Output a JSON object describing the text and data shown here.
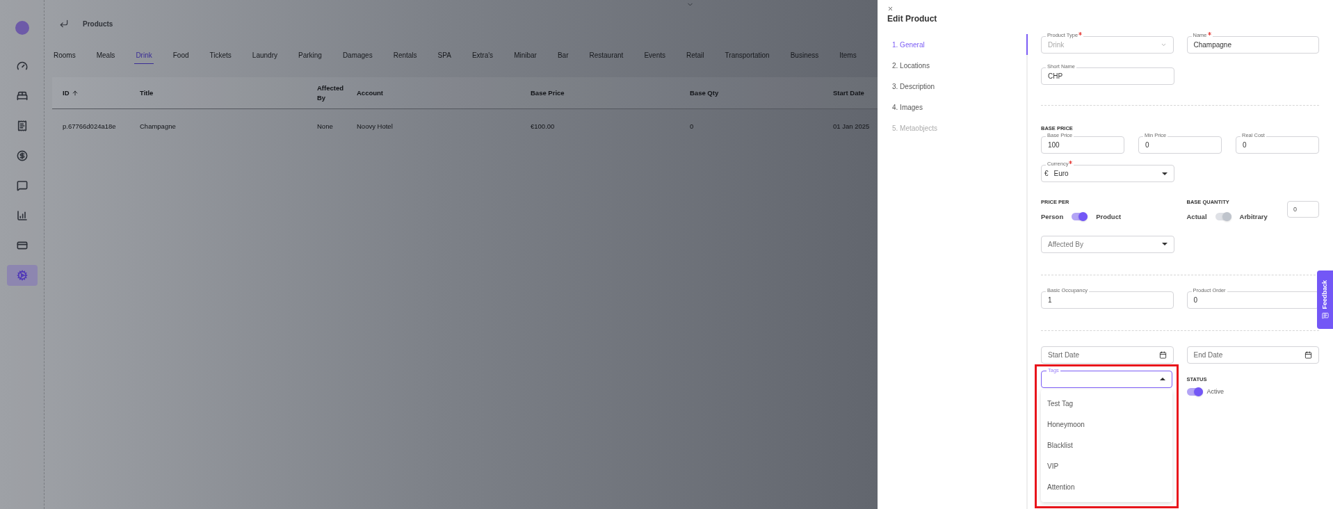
{
  "sidebar": {
    "items": [
      {
        "selected": false
      },
      {
        "selected": false
      },
      {
        "selected": false
      },
      {
        "selected": false
      },
      {
        "selected": false
      },
      {
        "selected": false
      },
      {
        "selected": false
      },
      {
        "selected": true
      }
    ]
  },
  "header": {
    "title": "Products"
  },
  "tabs": [
    {
      "label": "Rooms",
      "selected": false
    },
    {
      "label": "Meals",
      "selected": false
    },
    {
      "label": "Drink",
      "selected": true
    },
    {
      "label": "Food",
      "selected": false
    },
    {
      "label": "Tickets",
      "selected": false
    },
    {
      "label": "Laundry",
      "selected": false
    },
    {
      "label": "Parking",
      "selected": false
    },
    {
      "label": "Damages",
      "selected": false
    },
    {
      "label": "Rentals",
      "selected": false
    },
    {
      "label": "SPA",
      "selected": false
    },
    {
      "label": "Extra's",
      "selected": false
    },
    {
      "label": "Minibar",
      "selected": false
    },
    {
      "label": "Bar",
      "selected": false
    },
    {
      "label": "Restaurant",
      "selected": false
    },
    {
      "label": "Events",
      "selected": false
    },
    {
      "label": "Retail",
      "selected": false
    },
    {
      "label": "Transportation",
      "selected": false
    },
    {
      "label": "Business",
      "selected": false
    },
    {
      "label": "Items",
      "selected": false
    }
  ],
  "table": {
    "columns": [
      {
        "label": "ID",
        "sorted": true
      },
      {
        "label": "Title",
        "sorted": false
      },
      {
        "label": "Affected By",
        "sorted": false
      },
      {
        "label": "Account",
        "sorted": false
      },
      {
        "label": "Base Price",
        "sorted": false
      },
      {
        "label": "Base Qty",
        "sorted": false
      },
      {
        "label": "Start Date",
        "sorted": false
      }
    ],
    "rows": [
      [
        "p.67766d024a18e",
        "Champagne",
        "None",
        "Noovy Hotel",
        "€100.00",
        "0",
        "01 Jan 2025"
      ]
    ]
  },
  "drawer": {
    "title": "Edit Product",
    "steps": [
      {
        "label": "1. General",
        "selected": true,
        "disabled": false
      },
      {
        "label": "2. Locations",
        "selected": false,
        "disabled": false
      },
      {
        "label": "3. Description",
        "selected": false,
        "disabled": false
      },
      {
        "label": "4. Images",
        "selected": false,
        "disabled": false
      },
      {
        "label": "5. Metaobjects",
        "selected": false,
        "disabled": true
      }
    ],
    "product_type": {
      "label": "Product Type",
      "required": true,
      "value": "Drink",
      "disabled": true
    },
    "name": {
      "label": "Name",
      "required": true,
      "value": "Champagne"
    },
    "short_name": {
      "label": "Short Name",
      "value": "CHP"
    },
    "base_price_heading": "BASE PRICE",
    "base_price": {
      "label": "Base Price",
      "value": "100"
    },
    "min_price": {
      "label": "Min Price",
      "value": "0"
    },
    "real_cost": {
      "label": "Real Cost",
      "value": "0"
    },
    "currency": {
      "label": "Currency",
      "required": true,
      "symbol": "€",
      "value": "Euro"
    },
    "price_per": {
      "heading": "PRICE PER",
      "left": "Person",
      "right": "Product",
      "on": true,
      "disabled": false
    },
    "base_quantity": {
      "heading": "BASE QUANTITY",
      "left": "Actual",
      "right": "Arbitrary",
      "on": true,
      "disabled": true,
      "value": "0"
    },
    "affected_by": {
      "placeholder": "Affected By"
    },
    "basic_occupancy": {
      "label": "Basic Occupancy",
      "value": "1"
    },
    "product_order": {
      "label": "Product Order",
      "value": "0"
    },
    "start_date": {
      "placeholder": "Start Date"
    },
    "end_date": {
      "placeholder": "End Date"
    },
    "tags": {
      "label": "Tags",
      "expanded": true,
      "options": [
        "Test Tag",
        "Honeymoon",
        "Blacklist",
        "VIP",
        "Attention"
      ]
    },
    "status": {
      "heading": "STATUS",
      "label": "Active",
      "on": true
    }
  },
  "feedback": {
    "label": "Feedback"
  }
}
